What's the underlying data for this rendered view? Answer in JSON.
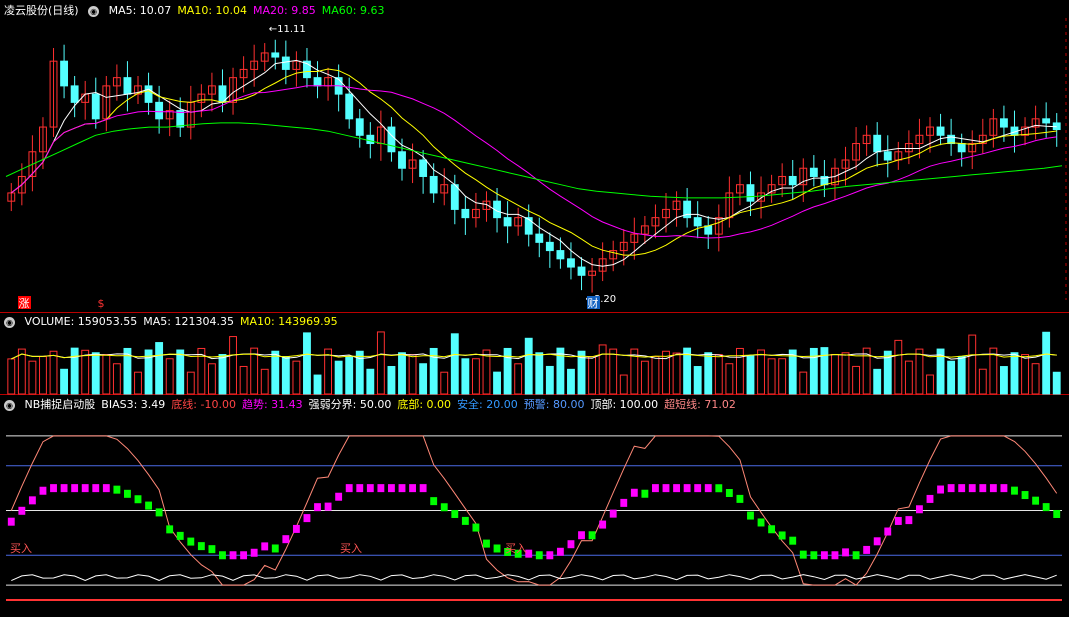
{
  "price_panel": {
    "title": "凌云股份(日线)",
    "ma_labels": [
      {
        "text": "MA5: 10.07",
        "color": "#ffffff"
      },
      {
        "text": "MA10: 10.04",
        "color": "#ffff00"
      },
      {
        "text": "MA20: 9.85",
        "color": "#ff00ff"
      },
      {
        "text": "MA60: 9.63",
        "color": "#00ff00"
      }
    ],
    "high_label": "11.11",
    "low_label": "8.20",
    "markers": [
      {
        "text": "涨",
        "color": "#ffffff",
        "bg": "#ff0000"
      },
      {
        "text": "$",
        "color": "#ff3333",
        "bg": ""
      },
      {
        "text": "财",
        "color": "#ffffff",
        "bg": "#1060c0"
      }
    ]
  },
  "volume_panel": {
    "labels": [
      {
        "text": "VOLUME: 159053.55",
        "color": "#ffffff"
      },
      {
        "text": "MA5: 121304.35",
        "color": "#ffffff"
      },
      {
        "text": "MA10: 143969.95",
        "color": "#ffff00"
      }
    ]
  },
  "indicator_panel": {
    "labels": [
      {
        "text": "NB捕捉启动股",
        "color": "#ffffff"
      },
      {
        "text": "BIAS3: 3.49",
        "color": "#ffffff"
      },
      {
        "text": "底线: -10.00",
        "color": "#ff4444"
      },
      {
        "text": "趋势: 31.43",
        "color": "#ff00ff"
      },
      {
        "text": "强弱分界: 50.00",
        "color": "#ffffff"
      },
      {
        "text": "底部: 0.00",
        "color": "#ffff00"
      },
      {
        "text": "安全: 20.00",
        "color": "#3399ff"
      },
      {
        "text": "预警: 80.00",
        "color": "#5599ff"
      },
      {
        "text": "顶部: 100.00",
        "color": "#ffffff"
      },
      {
        "text": "超短线: 71.02",
        "color": "#ff8888"
      }
    ],
    "buy_label": "买入"
  },
  "chart_data": [
    {
      "type": "candlestick",
      "title": "凌云股份(日线)",
      "series": [
        {
          "name": "MA5",
          "color": "#ffffff"
        },
        {
          "name": "MA10",
          "color": "#ffff00"
        },
        {
          "name": "MA20",
          "color": "#ff00ff"
        },
        {
          "name": "MA60",
          "color": "#00ff00"
        }
      ],
      "ylim": [
        8.0,
        11.4
      ],
      "close": [
        9.3,
        9.5,
        9.8,
        10.1,
        10.9,
        10.6,
        10.4,
        10.5,
        10.2,
        10.6,
        10.7,
        10.5,
        10.6,
        10.4,
        10.2,
        10.3,
        10.1,
        10.4,
        10.5,
        10.6,
        10.4,
        10.7,
        10.8,
        10.9,
        11.0,
        10.95,
        10.8,
        10.9,
        10.7,
        10.6,
        10.7,
        10.5,
        10.2,
        10.0,
        9.9,
        10.1,
        9.8,
        9.6,
        9.7,
        9.5,
        9.3,
        9.4,
        9.1,
        9.0,
        9.1,
        9.2,
        9.0,
        8.9,
        9.0,
        8.8,
        8.7,
        8.6,
        8.5,
        8.4,
        8.3,
        8.35,
        8.5,
        8.6,
        8.7,
        8.8,
        8.9,
        9.0,
        9.1,
        9.2,
        9.0,
        8.9,
        8.8,
        9.0,
        9.3,
        9.4,
        9.2,
        9.3,
        9.4,
        9.5,
        9.4,
        9.6,
        9.5,
        9.4,
        9.6,
        9.7,
        9.9,
        10.0,
        9.8,
        9.7,
        9.8,
        9.9,
        10.0,
        10.1,
        10.0,
        9.9,
        9.8,
        9.9,
        10.0,
        10.2,
        10.1,
        10.0,
        10.1,
        10.2,
        10.15,
        10.07
      ],
      "ma60": [
        9.5,
        9.6,
        9.7,
        9.8,
        9.9,
        10.0,
        10.05,
        10.08,
        10.1,
        10.1,
        10.12,
        10.14,
        10.15,
        10.15,
        10.14,
        10.12,
        10.1,
        10.08,
        10.05,
        10.0,
        9.95,
        9.9,
        9.85,
        9.8,
        9.75,
        9.7,
        9.65,
        9.6,
        9.55,
        9.5,
        9.45,
        9.4,
        9.35,
        9.32,
        9.3,
        9.28,
        9.26,
        9.25,
        9.24,
        9.24,
        9.24,
        9.25,
        9.26,
        9.28,
        9.3,
        9.32,
        9.35,
        9.38,
        9.4,
        9.42,
        9.44,
        9.46,
        9.48,
        9.5,
        9.52,
        9.54,
        9.56,
        9.58,
        9.6,
        9.63
      ]
    },
    {
      "type": "bar",
      "title": "VOLUME",
      "series": [
        {
          "name": "VOLUME"
        },
        {
          "name": "MA5"
        },
        {
          "name": "MA10"
        }
      ],
      "values": [
        159053.55
      ],
      "ma5": 121304.35,
      "ma10": 143969.95
    },
    {
      "type": "line",
      "title": "NB捕捉启动股",
      "ylim": [
        -10,
        110
      ],
      "reference_lines": [
        {
          "name": "底部",
          "value": 0
        },
        {
          "name": "安全",
          "value": 20
        },
        {
          "name": "强弱分界",
          "value": 50
        },
        {
          "name": "预警",
          "value": 80
        },
        {
          "name": "顶部",
          "value": 100
        }
      ],
      "series": [
        {
          "name": "BIAS3",
          "last": 3.49
        },
        {
          "name": "底线",
          "last": -10.0
        },
        {
          "name": "趋势",
          "last": 31.43
        },
        {
          "name": "超短线",
          "last": 71.02
        }
      ]
    }
  ]
}
